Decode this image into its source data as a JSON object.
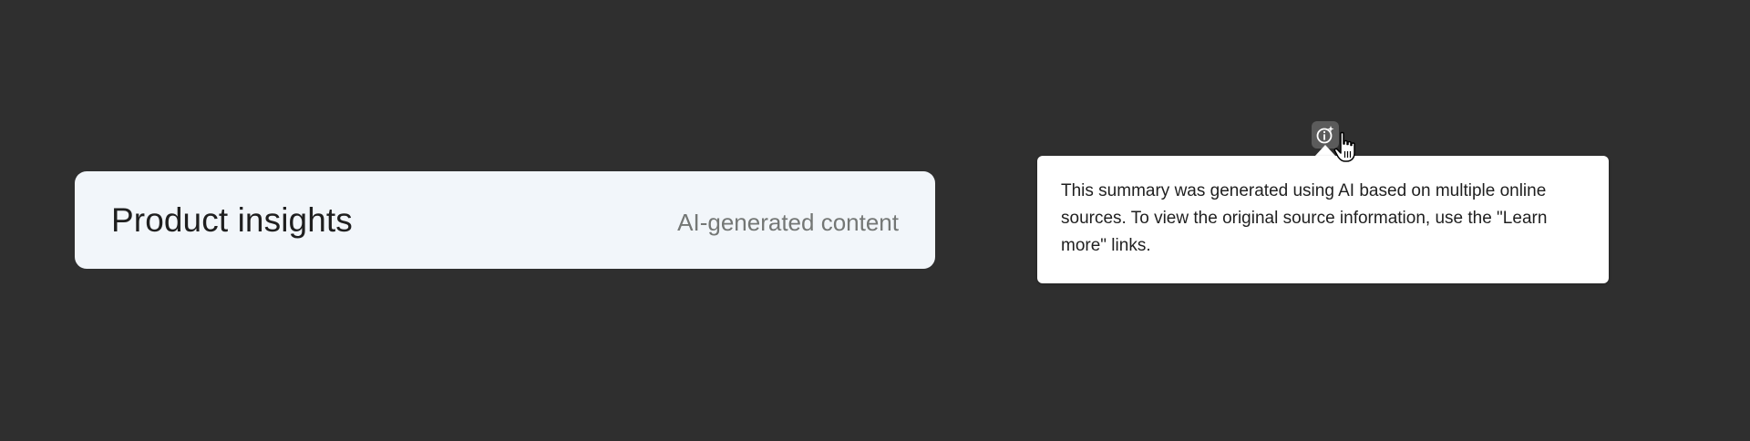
{
  "card": {
    "title": "Product insights",
    "badge": "AI-generated content"
  },
  "info_button": {
    "icon": "info-sparkle-icon"
  },
  "tooltip": {
    "text": "This summary was generated using AI based on multiple online sources. To view the original source information, use the \"Learn more\" links."
  },
  "colors": {
    "background": "#2f2f2f",
    "card_bg": "#f2f6fa",
    "title": "#1f1f1f",
    "badge": "#747775",
    "info_button_bg": "#5b5b5b",
    "tooltip_bg": "#ffffff"
  }
}
